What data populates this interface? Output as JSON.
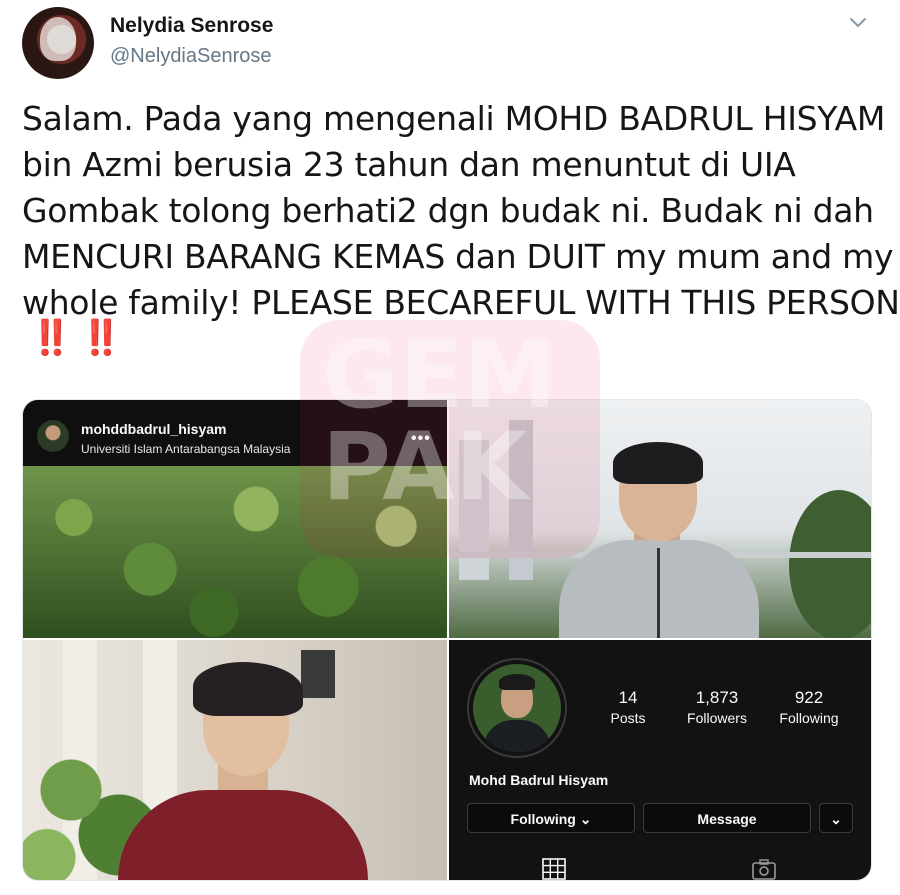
{
  "tweet": {
    "author_name": "Nelydia Senrose",
    "author_handle": "@NelydiaSenrose",
    "text_lines": [
      "Salam. Pada yang mengenali MOHD BADRUL HISYAM",
      "bin Azmi berusia 23 tahun dan menuntut di UIA",
      "Gombak tolong berhati2 dgn budak ni. Budak ni dah",
      "MENCURI BARANG KEMAS dan DUIT my mum and my",
      "whole family! PLEASE BECAREFUL WITH THIS PERSON"
    ],
    "emoji": "‼️ ‼️",
    "icons": {
      "menu": "chevron-down-icon"
    }
  },
  "media": {
    "post": {
      "username": "mohddbadrul_hisyam",
      "location": "Universiti Islam Antarabangsa Malaysia",
      "more": "•••"
    },
    "profile": {
      "posts_count": "14",
      "posts_label": "Posts",
      "followers_count": "1,873",
      "followers_label": "Followers",
      "following_count": "922",
      "following_label": "Following",
      "display_name": "Mohd Badrul Hisyam",
      "following_button": "Following ⌄",
      "message_button": "Message",
      "dropdown_button": "⌄",
      "icons": {
        "grid": "grid-icon",
        "tagged": "camera-icon"
      }
    }
  },
  "watermark": {
    "text_line1": "GEM",
    "text_line2": "PAK"
  },
  "colors": {
    "accent_red": "#c8102e",
    "handle_gray": "#657786",
    "ig_dark": "#121212"
  }
}
